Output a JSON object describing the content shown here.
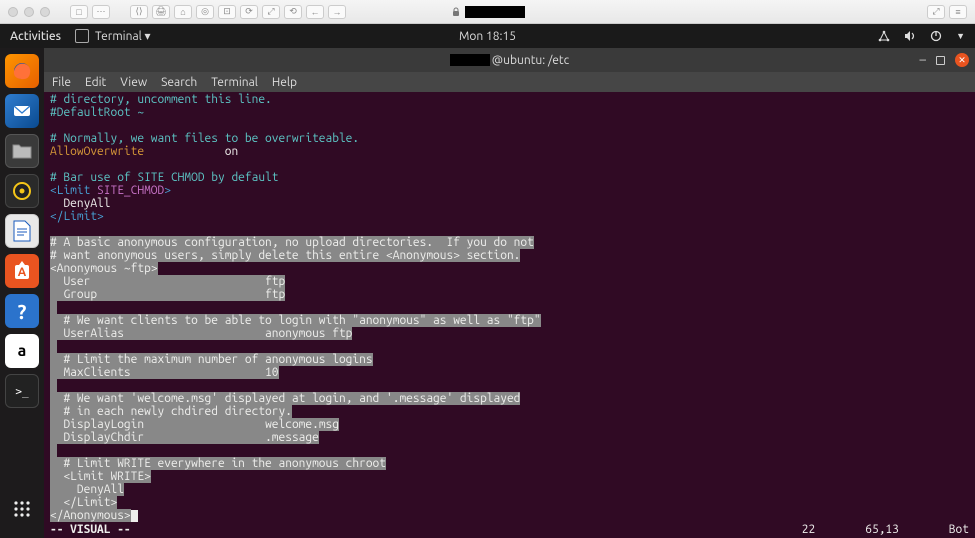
{
  "mac_toolbar": {
    "tools": [
      "□",
      "⋯",
      "⟨⟩",
      "🖨",
      "⌂",
      "◎",
      "⊡",
      "⟳",
      "⤢",
      "⟲",
      "←",
      "→"
    ]
  },
  "gnome": {
    "activities": "Activities",
    "app_label": "Terminal ▾",
    "clock": "Mon 18:15"
  },
  "window": {
    "title": "@ubuntu: /etc",
    "menu": [
      "File",
      "Edit",
      "View",
      "Search",
      "Terminal",
      "Help"
    ]
  },
  "launcher": {
    "items": [
      "firefox",
      "thunderbird",
      "files",
      "rhythmbox",
      "libreoffice",
      "software",
      "help",
      "amazon",
      "terminal"
    ]
  },
  "editor": {
    "lines": [
      {
        "t": "comment",
        "s": false,
        "x": "# directory, uncomment this line."
      },
      {
        "t": "comment",
        "s": false,
        "x": "#DefaultRoot ~"
      },
      {
        "t": "blank",
        "s": false,
        "x": ""
      },
      {
        "t": "comment",
        "s": false,
        "x": "# Normally, we want files to be overwriteable."
      },
      {
        "t": "kv",
        "s": false,
        "k": "AllowOverwrite",
        "p": "            ",
        "v": "on"
      },
      {
        "t": "blank",
        "s": false,
        "x": ""
      },
      {
        "t": "comment",
        "s": false,
        "x": "# Bar use of SITE CHMOD by default"
      },
      {
        "t": "tag",
        "s": false,
        "open": "<Limit ",
        "name": "SITE_CHMOD",
        "close": ">"
      },
      {
        "t": "plain",
        "s": false,
        "x": "  DenyAll"
      },
      {
        "t": "endtag",
        "s": false,
        "x": "</Limit>"
      },
      {
        "t": "blank",
        "s": false,
        "x": ""
      },
      {
        "t": "comment",
        "s": true,
        "x": "# A basic anonymous configuration, no upload directories.  If you do not"
      },
      {
        "t": "comment",
        "s": true,
        "x": "# want anonymous users, simply delete this entire <Anonymous> section."
      },
      {
        "t": "tag",
        "s": true,
        "open": "<Anonymous ",
        "name": "~ftp",
        "close": ">"
      },
      {
        "t": "kv",
        "s": true,
        "k": "  User",
        "p": "                          ",
        "v": "ftp"
      },
      {
        "t": "kv",
        "s": true,
        "k": "  Group",
        "p": "                         ",
        "v": "ftp"
      },
      {
        "t": "blank",
        "s": true,
        "x": " "
      },
      {
        "t": "comment",
        "s": true,
        "x": "  # We want clients to be able to login with \"anonymous\" as well as \"ftp\""
      },
      {
        "t": "kv",
        "s": true,
        "k": "  UserAlias",
        "p": "                     ",
        "v": "anonymous ftp"
      },
      {
        "t": "blank",
        "s": true,
        "x": " "
      },
      {
        "t": "comment",
        "s": true,
        "x": "  # Limit the maximum number of anonymous logins"
      },
      {
        "t": "kv",
        "s": true,
        "k": "  MaxClients",
        "p": "                    ",
        "v": "10"
      },
      {
        "t": "blank",
        "s": true,
        "x": " "
      },
      {
        "t": "comment",
        "s": true,
        "x": "  # We want 'welcome.msg' displayed at login, and '.message' displayed"
      },
      {
        "t": "comment",
        "s": true,
        "x": "  # in each newly chdired directory."
      },
      {
        "t": "kv",
        "s": true,
        "k": "  DisplayLogin",
        "p": "                  ",
        "v": "welcome.msg"
      },
      {
        "t": "kv",
        "s": true,
        "k": "  DisplayChdir",
        "p": "                  ",
        "v": ".message"
      },
      {
        "t": "blank",
        "s": true,
        "x": " "
      },
      {
        "t": "comment",
        "s": true,
        "x": "  # Limit WRITE everywhere in the anonymous chroot"
      },
      {
        "t": "tag",
        "s": true,
        "open": "  <Limit ",
        "name": "WRITE",
        "close": ">"
      },
      {
        "t": "plain",
        "s": true,
        "x": "    DenyAll"
      },
      {
        "t": "endtag",
        "s": true,
        "x": "  </Limit>"
      },
      {
        "t": "endtag",
        "s": true,
        "x": "</Anonymous>",
        "cursor": true
      }
    ],
    "status": {
      "mode": "-- VISUAL --",
      "count": "22",
      "pos": "65,13",
      "scroll": "Bot"
    }
  }
}
